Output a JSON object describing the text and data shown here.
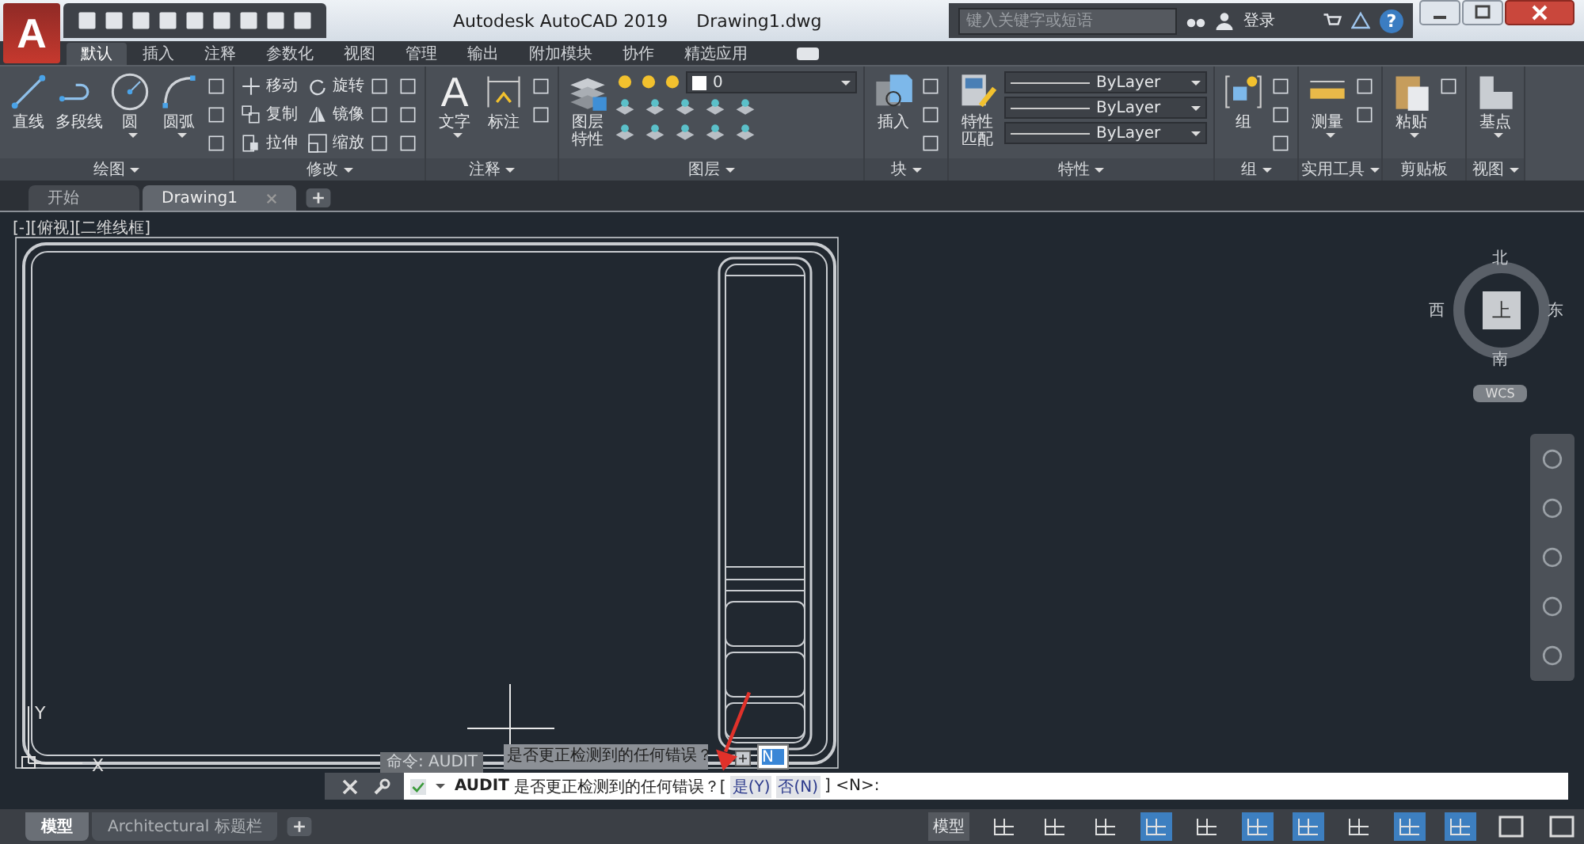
{
  "window": {
    "logo": "A",
    "title": "Autodesk AutoCAD 2019",
    "file": "Drawing1.dwg"
  },
  "search": {
    "placeholder": "键入关键字或短语"
  },
  "account": {
    "label": "登录"
  },
  "help": {
    "label": "?"
  },
  "ribbon_tabs": [
    {
      "label": "默认",
      "selected": true
    },
    {
      "label": "插入",
      "selected": false
    },
    {
      "label": "注释",
      "selected": false
    },
    {
      "label": "参数化",
      "selected": false
    },
    {
      "label": "视图",
      "selected": false
    },
    {
      "label": "管理",
      "selected": false
    },
    {
      "label": "输出",
      "selected": false
    },
    {
      "label": "附加模块",
      "selected": false
    },
    {
      "label": "协作",
      "selected": false
    },
    {
      "label": "精选应用",
      "selected": false
    }
  ],
  "panels": [
    {
      "title": "绘图",
      "title_menu": true,
      "tools": [
        {
          "kind": "big",
          "label": "直线",
          "menu": false
        },
        {
          "kind": "big",
          "label": "多段线",
          "menu": false
        },
        {
          "kind": "big",
          "label": "圆",
          "menu": true
        },
        {
          "kind": "big",
          "label": "圆弧",
          "menu": true
        }
      ]
    },
    {
      "title": "修改",
      "title_menu": true,
      "tools": [
        {
          "kind": "small",
          "label": "移动"
        },
        {
          "kind": "small",
          "label": "复制"
        },
        {
          "kind": "small",
          "label": "拉伸"
        },
        {
          "kind": "small",
          "label": "旋转"
        },
        {
          "kind": "small",
          "label": "镜像"
        },
        {
          "kind": "small",
          "label": "缩放"
        }
      ]
    },
    {
      "title": "注释",
      "title_menu": true,
      "tools": [
        {
          "kind": "glyph",
          "glyph": "A",
          "label": "文字",
          "menu": true
        },
        {
          "kind": "big",
          "label": "标注",
          "menu": false
        }
      ]
    },
    {
      "title": "图层",
      "title_menu": true,
      "tools": [
        {
          "kind": "big",
          "label": "图层特性",
          "menu": false
        },
        {
          "kind": "layer",
          "value": "0"
        }
      ]
    },
    {
      "title": "块",
      "title_menu": true,
      "tools": [
        {
          "kind": "big",
          "label": "插入",
          "menu": false
        }
      ]
    },
    {
      "title": "特性",
      "title_menu": true,
      "tools": [
        {
          "kind": "big",
          "label": "特性匹配",
          "menu": false
        },
        {
          "kind": "dropdown",
          "value": "ByLayer"
        },
        {
          "kind": "dropdown",
          "value": "ByLayer"
        },
        {
          "kind": "dropdown",
          "value": "ByLayer"
        }
      ]
    },
    {
      "title": "组",
      "title_menu": true,
      "tools": [
        {
          "kind": "big",
          "label": "组",
          "menu": false
        }
      ]
    },
    {
      "title": "实用工具",
      "title_menu": true,
      "tools": [
        {
          "kind": "big",
          "label": "测量",
          "menu": true
        }
      ]
    },
    {
      "title": "剪贴板",
      "title_menu": false,
      "tools": [
        {
          "kind": "big",
          "label": "粘贴",
          "menu": true
        }
      ]
    },
    {
      "title": "视图",
      "title_menu": true,
      "tools": [
        {
          "kind": "big",
          "label": "基点",
          "menu": true
        }
      ]
    }
  ],
  "doc_tabs": [
    {
      "label": "开始",
      "selected": false
    },
    {
      "label": "Drawing1",
      "selected": true
    }
  ],
  "viewport": {
    "label": "[-][俯视][二维线框]"
  },
  "ucs_icon": {
    "x_label": "X",
    "y_label": "Y"
  },
  "viewcube": {
    "north": "北",
    "south": "南",
    "west": "西",
    "east": "东",
    "face": "上",
    "coord": "WCS"
  },
  "command": {
    "history": "命令: AUDIT",
    "tooltip": "是否更正检测到的任何错误？",
    "input": "N",
    "name": "AUDIT",
    "prompt": "是否更正检测到的任何错误？[",
    "options": [
      "是(Y)",
      "否(N)"
    ],
    "suffix": "] <N>:"
  },
  "layout_tabs": [
    {
      "label": "模型",
      "selected": true
    },
    {
      "label": "Architectural 标题栏",
      "selected": false
    }
  ],
  "status": {
    "model": "模型",
    "toggles": [
      {
        "on": false
      },
      {
        "on": false
      },
      {
        "on": false
      },
      {
        "on": true
      },
      {
        "on": false
      },
      {
        "on": true
      },
      {
        "on": true
      },
      {
        "on": false
      },
      {
        "on": true
      },
      {
        "on": true
      }
    ]
  }
}
